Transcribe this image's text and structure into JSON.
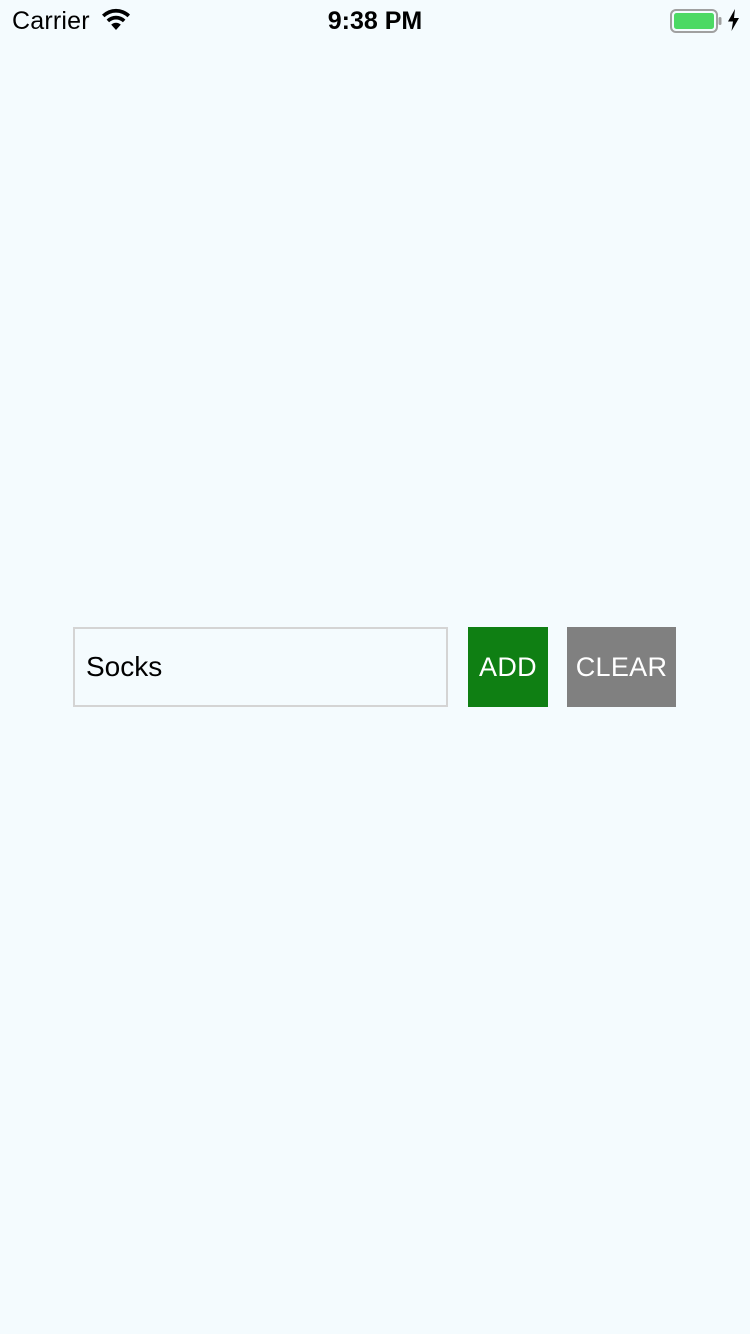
{
  "status_bar": {
    "carrier": "Carrier",
    "time": "9:38 PM",
    "wifi_icon": "wifi-icon",
    "battery_icon": "battery-icon",
    "battery_level": 1.0,
    "battery_color": "#4cd964",
    "charging_icon": "charging-bolt-icon"
  },
  "form": {
    "item_value": "Socks",
    "add_label": "ADD",
    "clear_label": "CLEAR"
  },
  "colors": {
    "background": "#f4fbfe",
    "add_button": "#0f7f13",
    "clear_button": "#808080",
    "input_border": "#d4d4d4"
  }
}
